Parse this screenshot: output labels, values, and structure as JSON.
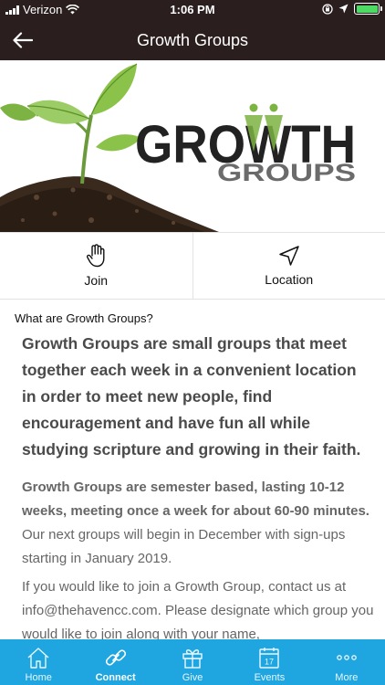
{
  "status_bar": {
    "carrier": "Verizon",
    "time": "1:06 PM",
    "battery_color": "#4cd964"
  },
  "nav": {
    "title": "Growth Groups",
    "back_icon": "arrow-left-icon"
  },
  "hero": {
    "logo_top": "GROWTH",
    "logo_bottom": "GROUPS"
  },
  "actions": [
    {
      "label": "Join",
      "icon": "hand-pointer-icon"
    },
    {
      "label": "Location",
      "icon": "navigation-arrow-icon"
    }
  ],
  "content": {
    "section_label": "What are Growth Groups?",
    "lead": "Growth Groups are small groups that meet together each week in a convenient location in order to meet new people, find encouragement and have fun all while studying scripture and growing in their faith.",
    "p1_bold": "Growth Groups are semester based, lasting 10-12 weeks, meeting once a week for about 60-90 minutes.",
    "p1_rest": " Our next groups will begin in December with sign-ups starting in January 2019.",
    "p2": "If you would like to join a Growth Group, contact us at info@thehavencc.com. Please designate which group you would like to join along with your name,"
  },
  "tabs": [
    {
      "label": "Home",
      "icon": "home-icon",
      "active": false
    },
    {
      "label": "Connect",
      "icon": "link-icon",
      "active": true
    },
    {
      "label": "Give",
      "icon": "gift-icon",
      "active": false
    },
    {
      "label": "Events",
      "icon": "calendar-icon",
      "active": false
    },
    {
      "label": "More",
      "icon": "more-dots-icon",
      "active": false
    }
  ],
  "colors": {
    "header_bg": "#2a1e1e",
    "tab_bar_bg": "#1fa6e0",
    "logo_dark": "#222222",
    "logo_green": "#7cb342",
    "logo_gray": "#6b6b6b"
  }
}
